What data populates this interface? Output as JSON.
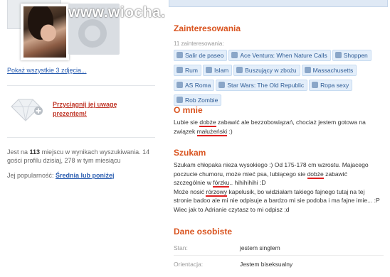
{
  "watermark": "www.wiocha.pl",
  "left": {
    "show_all_link": "Pokaż wszystkie 3 zdjęcia...",
    "gift_link_line1": "Przyciągnij jej uwagę",
    "gift_link_line2": "prezentem!",
    "rank_pre": "Jest na ",
    "rank_num": "113",
    "rank_post": " miejscu w wynikach wyszukiwania. 14 gości profilu dzisiaj, 278 w tym miesiącu",
    "popularity_label": "Jej popularność: ",
    "popularity_value": "Średnia lub poniżej"
  },
  "interests": {
    "heading": "Zainteresowania",
    "count": "11 zainteresowania:",
    "tags": [
      "Salir de paseo",
      "Ace Ventura: When Nature Calls",
      "Shoppen",
      "Rum",
      "Islam",
      "Buszujący w zbożu",
      "Massachusetts",
      "AS Roma",
      "Star Wars: The Old Republic",
      "Ropa sexy",
      "Rob Zombie"
    ]
  },
  "about": {
    "heading": "O mnie",
    "t1": "Lubie sie ",
    "u1": "dobże",
    "t2": " zabawić ale bezzobowiązań, chociaż jestem gotowa na związek ",
    "u2": "małużeński",
    "t3": " :)"
  },
  "looking": {
    "heading": "Szukam",
    "t1": "Szukam chłopaka nieza wysokiego :) Od 175-178 cm wzrostu. Majacego poczucie chumoru, może mieć psa, lubiącego sie ",
    "u1": "dobże",
    "t2": " zabawić szczególnie w ",
    "u2": "fórzku",
    "t3": ".. hihihihihi :D",
    "t4": "Może nosić ",
    "u3": "rórzowy",
    "t5": " kapelusik, bo widziałam takiego fajnego tutaj na tej stronie badoo ale mi nie odpisuje a bardzo mi sie podoba i ma fajne imie... :P Wiec jak to Adrianie czytasz to mi odpisz ;d"
  },
  "personal": {
    "heading": "Dane osobiste",
    "rows": [
      {
        "label": "Stan:",
        "value": "jestem singlem"
      },
      {
        "label": "Orientacja:",
        "value": "Jestem biseksualny"
      }
    ]
  }
}
